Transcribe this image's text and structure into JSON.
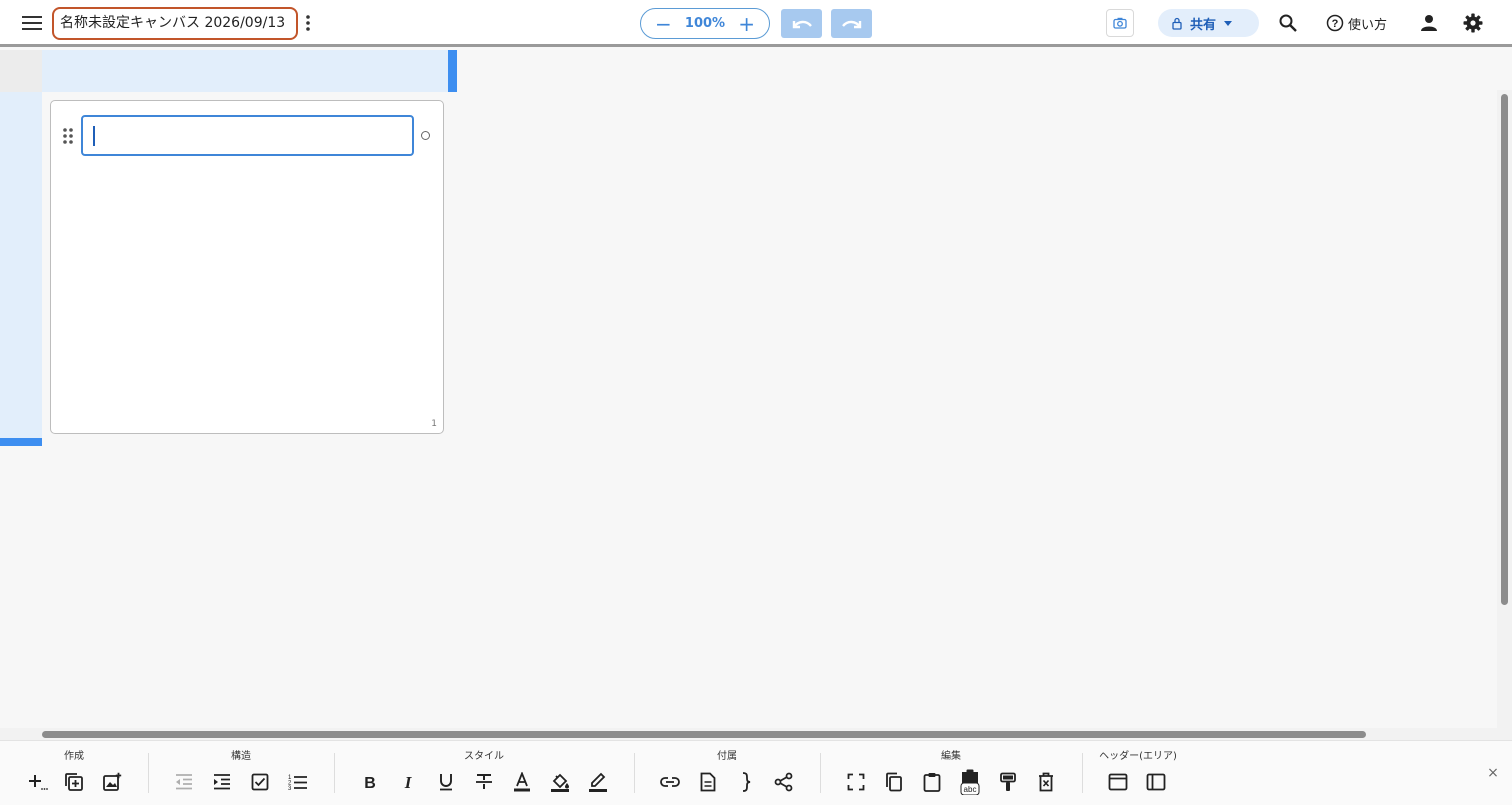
{
  "header": {
    "title": "名称未設定キャンバス 2026/09/13",
    "zoom": "100%",
    "share_label": "共有",
    "help_label": "使い方",
    "icons": [
      "menu-icon",
      "more-vert-icon",
      "zoom-out-icon",
      "zoom-in-icon",
      "undo-icon",
      "redo-icon",
      "camera-icon",
      "lock-icon",
      "search-icon",
      "help-icon",
      "user-icon",
      "gear-icon"
    ]
  },
  "canvas": {
    "card": {
      "text_value": "",
      "line_count": "1"
    }
  },
  "toolbar": {
    "groups": [
      {
        "label": "作成"
      },
      {
        "label": "構造"
      },
      {
        "label": "スタイル"
      },
      {
        "label": "付属"
      },
      {
        "label": "編集"
      },
      {
        "label": "ヘッダー(エリア)"
      }
    ],
    "close_label": "×"
  },
  "colors": {
    "accent": "#3f86d8",
    "title_border": "#c2552a",
    "selection_bg": "#e2eefb",
    "selection_edge": "#3d8ef0"
  }
}
